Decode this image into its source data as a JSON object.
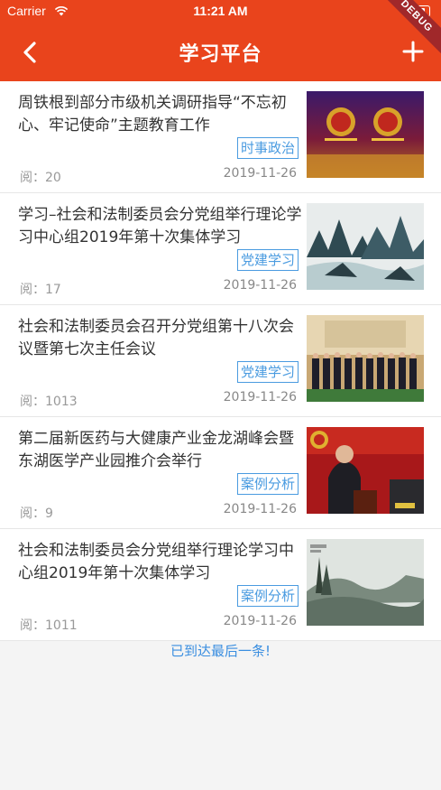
{
  "status": {
    "carrier": "Carrier",
    "time": "11:21 AM"
  },
  "debug_banner": "DEBUG",
  "navbar": {
    "title": "学习平台"
  },
  "articles": [
    {
      "title": "周铁根到部分市级机关调研指导“不忘初心、牢记使命”主题教育工作",
      "tag": "时事政治",
      "reads": "阅：20",
      "date": "2019-11-26"
    },
    {
      "title": "学习–社会和法制委员会分党组举行理论学习中心组2019年第十次集体学习",
      "tag": "党建学习",
      "reads": "阅：17",
      "date": "2019-11-26"
    },
    {
      "title": "社会和法制委员会召开分党组第十八次会议暨第七次主任会议",
      "tag": "党建学习",
      "reads": "阅：1013",
      "date": "2019-11-26"
    },
    {
      "title": "第二届新医药与大健康产业金龙湖峰会暨东湖医学产业园推介会举行",
      "tag": "案例分析",
      "reads": "阅：9",
      "date": "2019-11-26"
    },
    {
      "title": "社会和法制委员会分党组举行理论学习中心组2019年第十次集体学习",
      "tag": "案例分析",
      "reads": "阅：1011",
      "date": "2019-11-26"
    }
  ],
  "list_end_text": "已到达最后一条!",
  "colors": {
    "primary": "#e9441c",
    "tag": "#4a9be0",
    "end_text": "#3a8ee0"
  }
}
